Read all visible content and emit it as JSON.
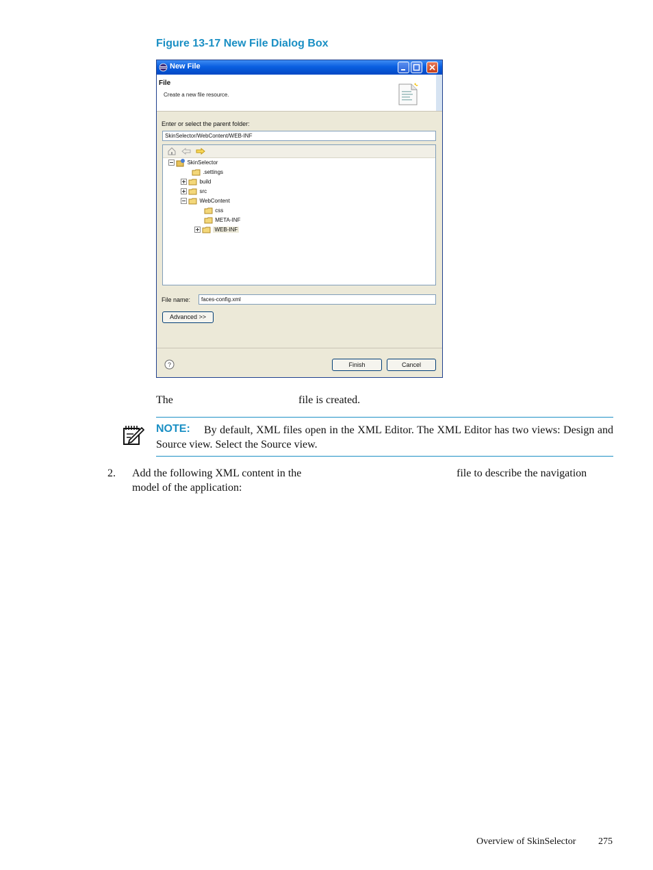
{
  "figure": {
    "caption": "Figure 13-17 New File Dialog Box"
  },
  "dialog": {
    "title": "New File",
    "header_title": "File",
    "header_desc": "Create a new file resource.",
    "parent_label": "Enter or select the parent folder:",
    "parent_value": "SkinSelector/WebContent/WEB-INF",
    "tree": [
      {
        "label": "SkinSelector"
      },
      {
        "label": ".settings"
      },
      {
        "label": "build"
      },
      {
        "label": "src"
      },
      {
        "label": "WebContent"
      },
      {
        "label": "css"
      },
      {
        "label": "META-INF"
      },
      {
        "label": "WEB-INF"
      }
    ],
    "file_name_label": "File name:",
    "file_name_value": "faces-config.xml",
    "advanced_label": "Advanced >>",
    "finish_label": "Finish",
    "cancel_label": "Cancel"
  },
  "body": {
    "created_prefix": "The",
    "created_suffix": "file is created.",
    "note_label": "NOTE:",
    "note_text": "By default, XML files open in the XML Editor. The XML Editor has two views: Design and Source view. Select the Source view.",
    "step_number": "2.",
    "step_text_a": "Add the following XML content in the",
    "step_text_b": "file to describe the navigation",
    "step_text_c": "model of the application:"
  },
  "footer": {
    "section": "Overview of SkinSelector",
    "page": "275"
  }
}
